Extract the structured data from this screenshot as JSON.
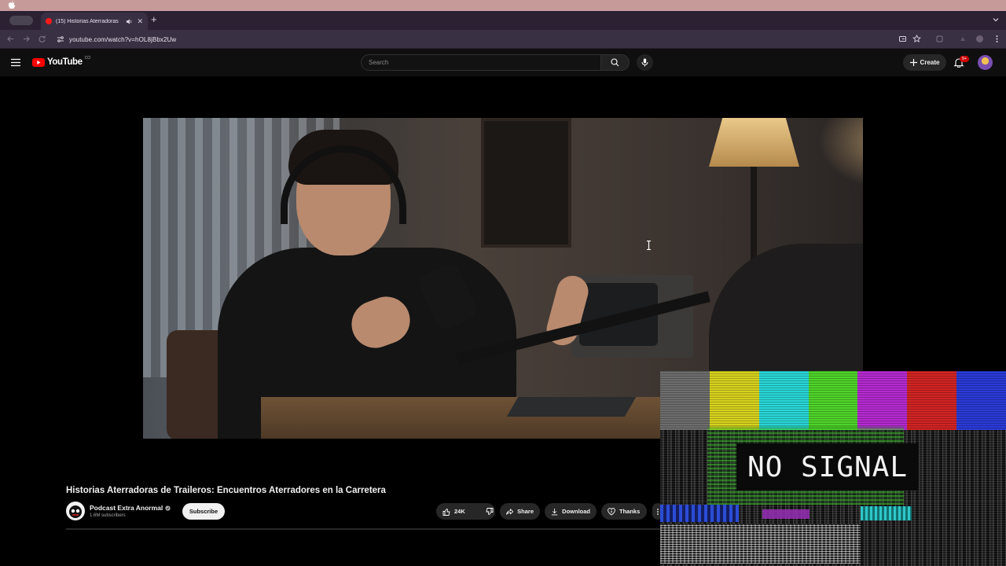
{
  "browser": {
    "tab": {
      "title": "(15) Historias Aterradoras",
      "favicon": "youtube-favicon",
      "audio_icon": "speaker-icon"
    },
    "url": "youtube.com/watch?v=hOL8jBbx2Uw"
  },
  "youtube": {
    "logo_text": "YouTube",
    "country_code": "CO",
    "search_placeholder": "Search",
    "create_label": "Create",
    "notification_count": "9+"
  },
  "video": {
    "title": "Historias Aterradoras de Traileros: Encuentros Aterradores en la Carretera",
    "channel_name": "Podcast Extra Anormal",
    "subscribers": "1.6M subscribers",
    "subscribe_label": "Subscribe",
    "likes": "24K",
    "share_label": "Share",
    "download_label": "Download",
    "thanks_label": "Thanks"
  },
  "overlay": {
    "text": "NO SIGNAL",
    "bar_colors": [
      "#6d6d6d",
      "#d8d21e",
      "#29d6d6",
      "#4fd42a",
      "#b42ad0",
      "#d22424",
      "#2a3ad6"
    ]
  }
}
